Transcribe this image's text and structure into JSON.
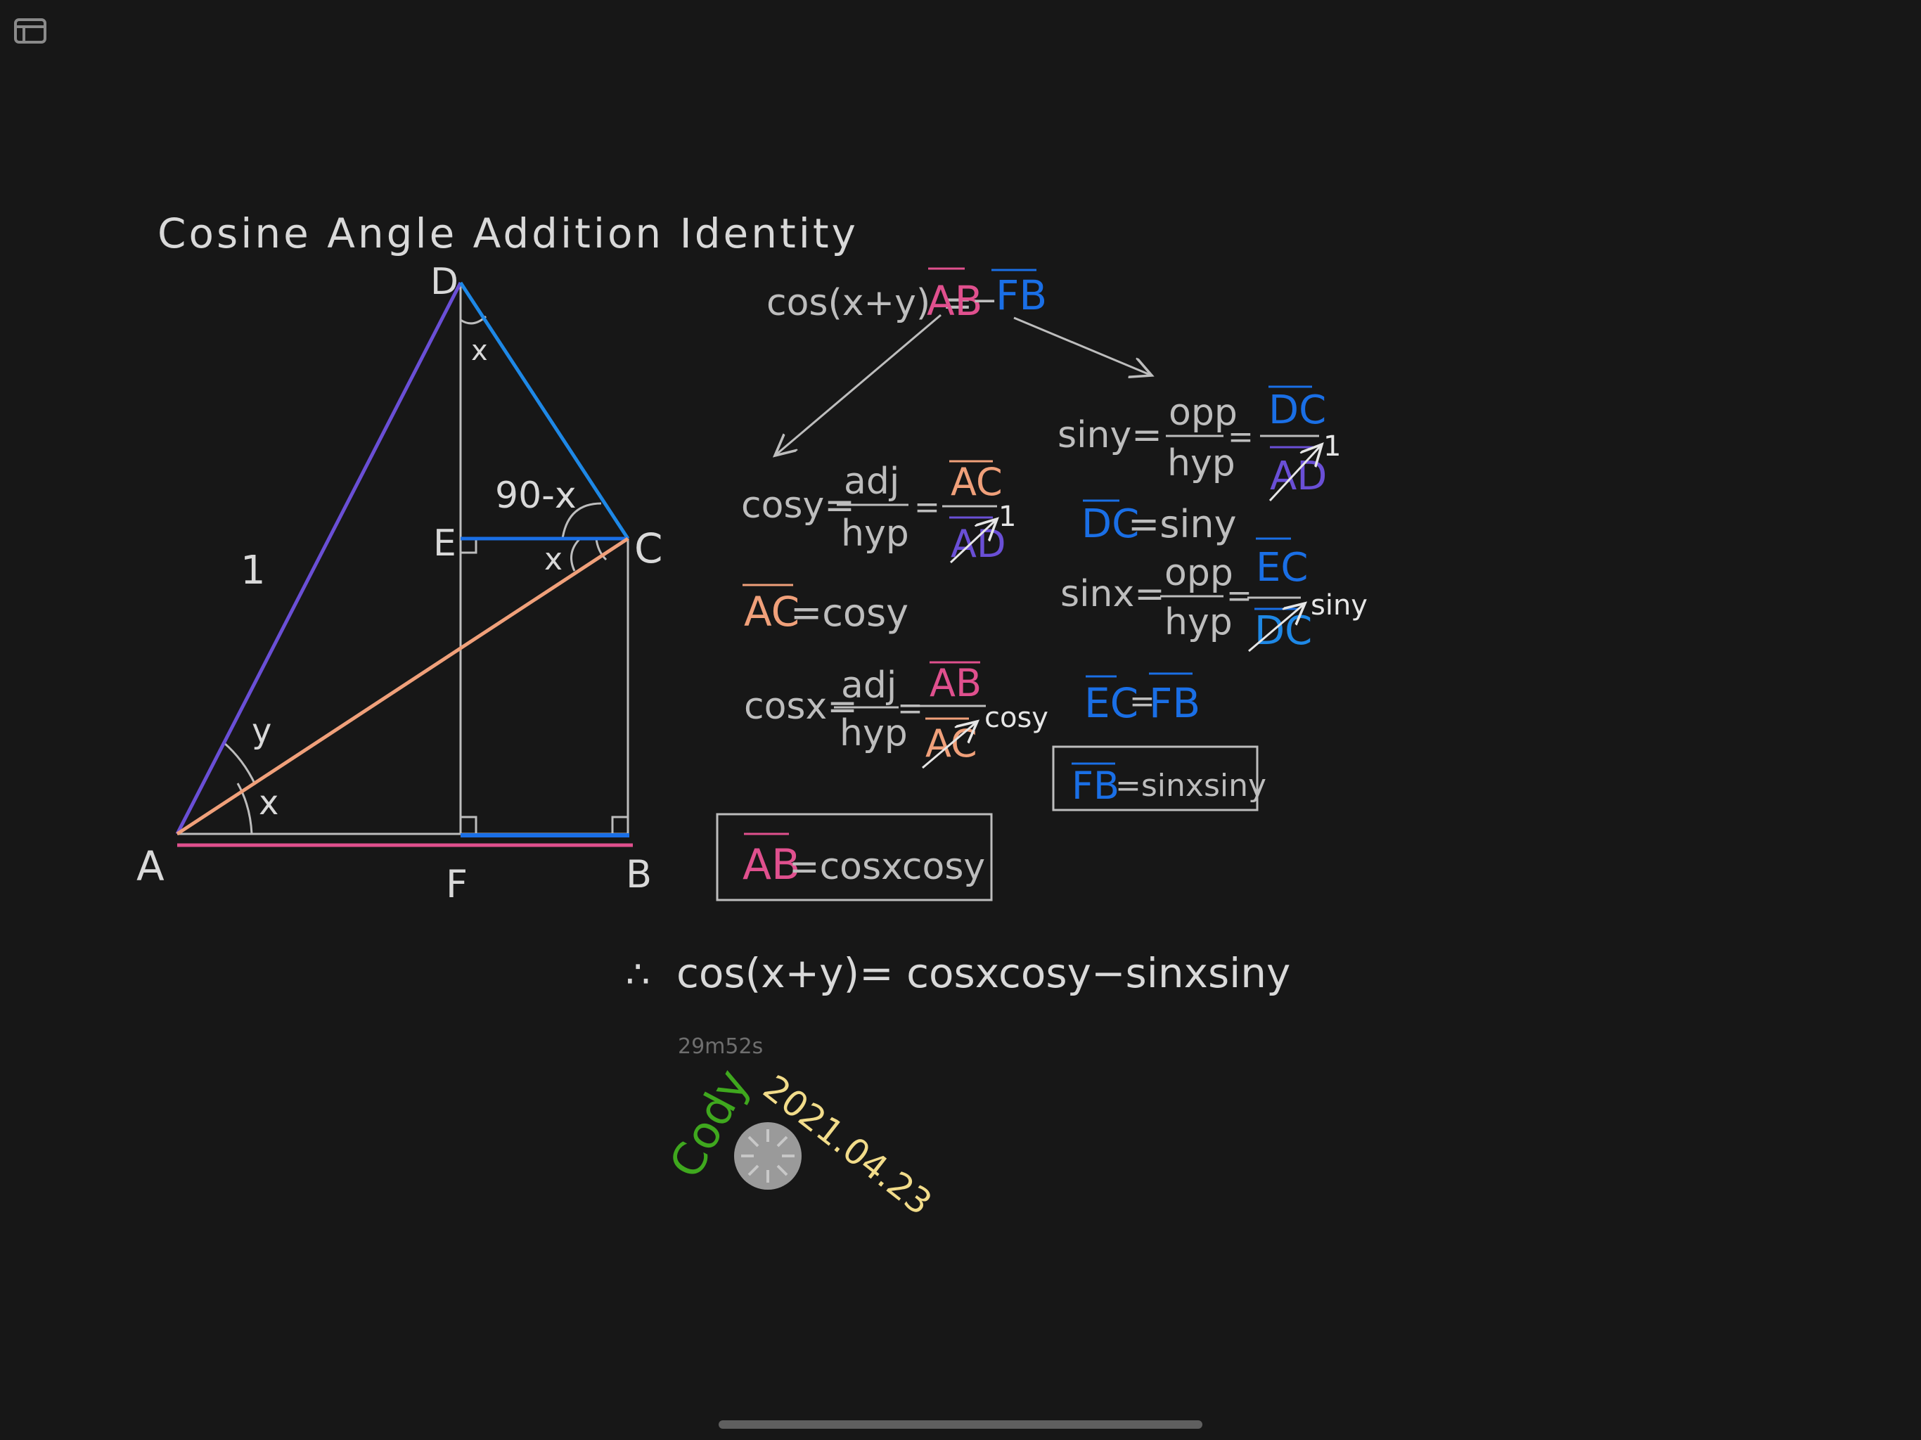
{
  "toolbar": {
    "sidebar_icon": "sidebar-icon"
  },
  "colors": {
    "background": "#171717",
    "chalk": "#d9d9d9",
    "gray_line": "#bdbdbd",
    "purple": "#6a4fd6",
    "blue": "#1a6fe6",
    "sky": "#1e88e6",
    "pink": "#e0508e",
    "orange": "#f0a07a",
    "green": "#3fa81e",
    "yellow": "#f2dc8a"
  },
  "title": "Cosine Angle Addition Identity",
  "diagram": {
    "labels": {
      "A": "A",
      "B": "B",
      "C": "C",
      "D": "D",
      "E": "E",
      "F": "F",
      "one": "1",
      "x_at_D": "x",
      "x_at_A": "x",
      "y_at_A": "y",
      "x_at_C": "x",
      "ninety_minus_x": "90-x"
    }
  },
  "equations": {
    "top": {
      "prefix": "cos(x+y) =",
      "ab": "AB",
      "minus": "−",
      "fb": "FB"
    },
    "cosy": {
      "lhs": "cosy=",
      "num": "adj",
      "den": "hyp",
      "eq": "=",
      "num2": "AC",
      "den2": "AD",
      "sub": "1"
    },
    "ac_result": {
      "ac": "AC",
      "rest": "=cosy"
    },
    "cosx": {
      "lhs": "cosx=",
      "num": "adj",
      "den": "hyp",
      "eq": "=",
      "num2": "AB",
      "den2": "AC",
      "sub": "cosy"
    },
    "ab_result": {
      "ab": "AB",
      "rest": "=cosxcosy"
    },
    "siny": {
      "lhs": "siny=",
      "num": "opp",
      "den": "hyp",
      "eq": "=",
      "num2": "DC",
      "den2": "AD",
      "sub": "1"
    },
    "dc_result": {
      "dc": "DC",
      "rest": "=siny"
    },
    "sinx": {
      "lhs": "sinx=",
      "num": "opp",
      "den": "hyp",
      "eq": "=",
      "num2": "EC",
      "den2": "DC",
      "sub": "siny"
    },
    "ec_fb": {
      "ec": "EC",
      "eq": "=",
      "fb": "FB"
    },
    "fb_result": {
      "fb": "FB",
      "rest": "=sinxsiny"
    },
    "conclusion": {
      "therefore": "∴",
      "text": "cos(x+y)= cosxcosy−sinxsiny"
    }
  },
  "signature": {
    "elapsed": "29m52s",
    "name": "Cody",
    "date": "2021.04.23"
  }
}
